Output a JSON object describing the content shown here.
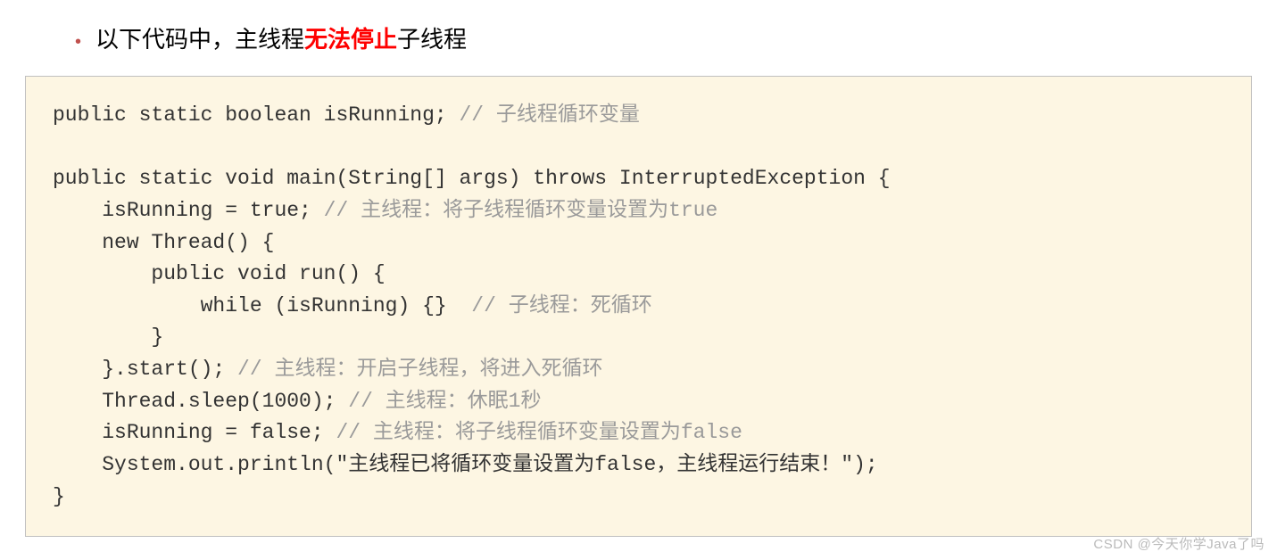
{
  "bullet": {
    "prefix": "以下代码中，主线程",
    "highlight": "无法停止",
    "suffix": "子线程"
  },
  "code": {
    "l1": "public static boolean isRunning; ",
    "c1": "// 子线程循环变量",
    "l2": "",
    "l3": "public static void main(String[] args) throws InterruptedException {",
    "l4": "    isRunning = true; ",
    "c4": "// 主线程：将子线程循环变量设置为true",
    "l5": "    new Thread() {",
    "l6": "        public void run() {",
    "l7": "            while (isRunning) {}  ",
    "c7": "// 子线程：死循环",
    "l8": "        }",
    "l9": "    }.start(); ",
    "c9": "// 主线程：开启子线程，将进入死循环",
    "l10": "    Thread.sleep(1000); ",
    "c10": "// 主线程：休眠1秒",
    "l11": "    isRunning = false; ",
    "c11": "// 主线程：将子线程循环变量设置为false",
    "l12": "    System.out.println(\"主线程已将循环变量设置为false，主线程运行结束！\");",
    "l13": "}"
  },
  "watermark": "CSDN @今天你学Java了吗"
}
